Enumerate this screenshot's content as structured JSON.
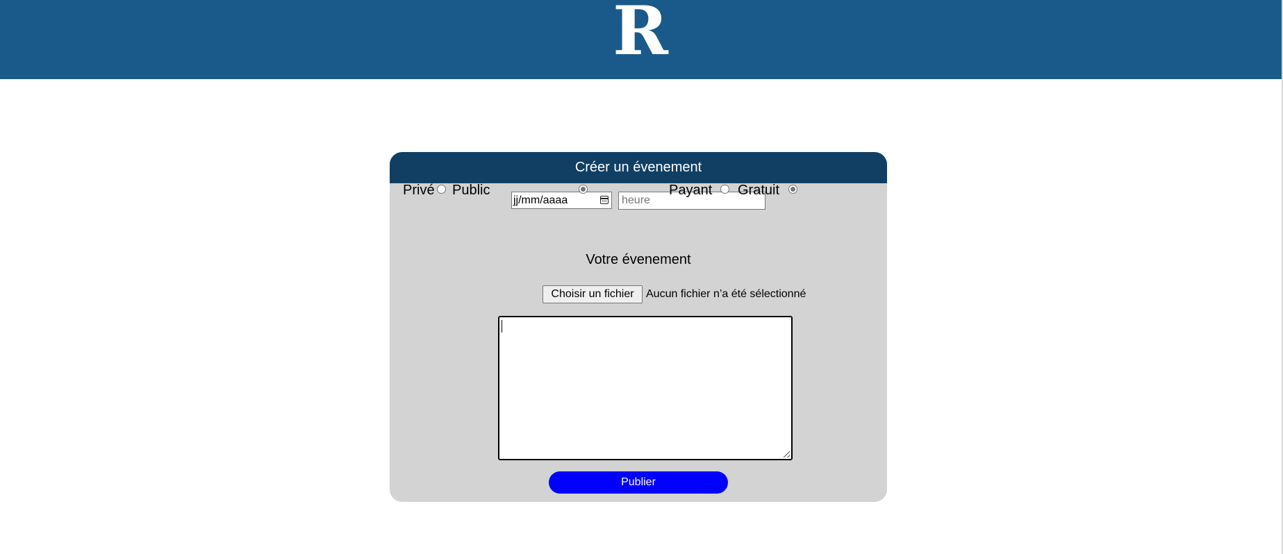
{
  "header": {
    "logo_letter": "R",
    "background_color": "#1a5a8a"
  },
  "form": {
    "title": "Créer un évenement",
    "date_placeholder": "jj/mm/aaaa",
    "time_placeholder": "heure",
    "visibility": {
      "option_private": "Privé",
      "option_public": "Public",
      "selected": "Public"
    },
    "pricing": {
      "option_paid": "Payant",
      "option_free": "Gratuit",
      "selected": "Gratuit"
    },
    "section_title": "Votre évenement",
    "file": {
      "button_label": "Choisir un fichier",
      "status": "Aucun fichier n’a été sélectionné"
    },
    "description_value": "",
    "publish_label": "Publier",
    "colors": {
      "header": "#113f63",
      "card": "#d3d3d3",
      "publish_button": "#0000ff"
    }
  }
}
